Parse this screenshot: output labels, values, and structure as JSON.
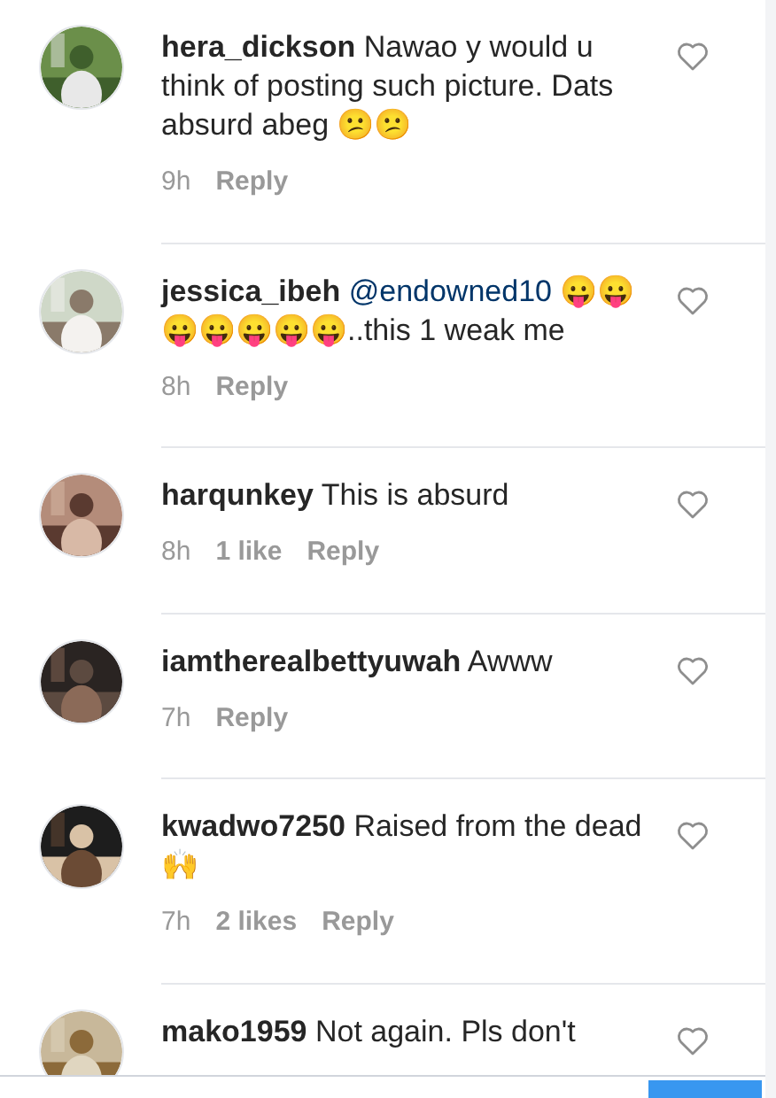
{
  "comments": [
    {
      "username": "hera_dickson",
      "text": "Nawao y would u think of posting such picture. Dats absurd abeg 😕😕",
      "time": "9h",
      "reply": "Reply"
    },
    {
      "username": "jessica_ibeh",
      "mention": "@endowned10",
      "text": "😛😛😛😛😛😛😛..this 1 weak me",
      "time": "8h",
      "reply": "Reply"
    },
    {
      "username": "harqunkey",
      "text": "This is absurd",
      "time": "8h",
      "likes": "1 like",
      "reply": "Reply"
    },
    {
      "username": "iamtherealbettyuwah",
      "text": "Awww",
      "time": "7h",
      "reply": "Reply"
    },
    {
      "username": "kwadwo7250",
      "text": "Raised from the dead🙌",
      "time": "7h",
      "likes": "2 likes",
      "reply": "Reply"
    },
    {
      "username": "mako1959",
      "text": "Not again. Pls don't"
    }
  ]
}
